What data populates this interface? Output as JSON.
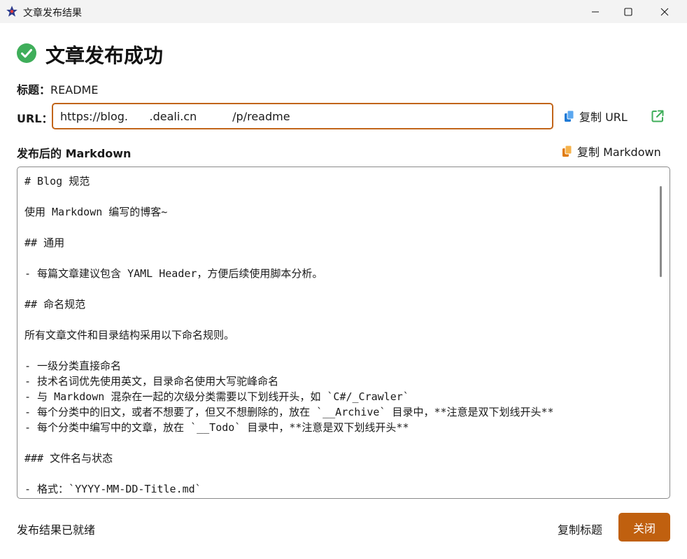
{
  "window": {
    "title": "文章发布结果",
    "icons": {
      "app": "star-app-icon",
      "minimize": "minimize-icon",
      "maximize": "maximize-icon",
      "close": "close-icon"
    }
  },
  "header": {
    "title": "文章发布成功",
    "icon": "check-circle-icon",
    "success_color": "#3fae5a"
  },
  "article": {
    "title_label": "标题：",
    "title_value": "README"
  },
  "url": {
    "label": "URL：",
    "value": "https://blog.      .deali.cn          /p/readme",
    "copy_label": "复制 URL",
    "copy_icon": "copy-icon",
    "open_icon": "external-link-icon"
  },
  "markdown": {
    "label": "发布后的 Markdown",
    "copy_label": "复制 Markdown",
    "copy_icon": "copy-icon",
    "content": "# Blog 规范\n\n使用 Markdown 编写的博客~\n\n## 通用\n\n- 每篇文章建议包含 YAML Header，方便后续使用脚本分析。\n\n## 命名规范\n\n所有文章文件和目录结构采用以下命名规则。\n\n- 一级分类直接命名\n- 技术名词优先使用英文，目录命名使用大写驼峰命名\n- 与 Markdown 混杂在一起的次级分类需要以下划线开头，如 `C#/_Crawler`\n- 每个分类中的旧文，或者不想要了，但又不想删除的，放在 `__Archive` 目录中，**注意是双下划线开头**\n- 每个分类中编写中的文章，放在 `__Todo` 目录中，**注意是双下划线开头**\n\n### 文件名与状态\n\n- 格式：`YYYY-MM-DD-Title.md`"
  },
  "footer": {
    "status": "发布结果已就绪",
    "copy_title_label": "复制标题",
    "close_label": "关闭",
    "accent_color": "#c0600f"
  }
}
